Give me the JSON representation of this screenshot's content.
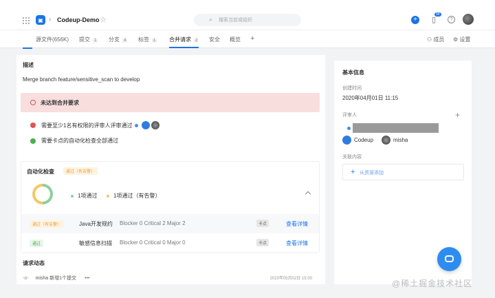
{
  "header": {
    "repo_name": "Codeup-Demo",
    "search_placeholder": "搜索当前或组织",
    "notify_count": "99"
  },
  "tabs": [
    {
      "label": "源文件(656K)",
      "count": ""
    },
    {
      "label": "提交",
      "count": "1"
    },
    {
      "label": "分支",
      "count": "4"
    },
    {
      "label": "标签",
      "count": "1"
    },
    {
      "label": "合并请求",
      "count": "2"
    },
    {
      "label": "安全",
      "count": ""
    },
    {
      "label": "概览",
      "count": ""
    }
  ],
  "tab_right": {
    "members": "成员",
    "settings": "设置"
  },
  "main": {
    "desc_title": "描述",
    "desc_text": "Merge branch feature/sensitive_scan to develop",
    "warning": "未达到合并要求",
    "checks": [
      {
        "text": "需要至少1名有权限的评审人评审通过",
        "status": "fail"
      },
      {
        "text": "需要卡点的自动化检查全部通过",
        "status": "pass"
      }
    ],
    "auto": {
      "title": "自动化检查",
      "status_tag": "通过（有告警）",
      "legend_pass": "1项通过",
      "legend_warn": "1项通过（有告警）",
      "rows": [
        {
          "tag": "通过（有告警）",
          "tag_type": "warn",
          "name": "Java开发规约",
          "detail": "Blocker 0 Critical 2 Major 2",
          "chip": "卡点",
          "link": "查看详情"
        },
        {
          "tag": "通过",
          "tag_type": "ok",
          "name": "敏感信息扫描",
          "detail": "Blocker 0 Critical 0 Major 0",
          "chip": "卡点",
          "link": "查看详情"
        }
      ]
    },
    "activity": {
      "title": "请求动态",
      "user": "misha",
      "action": "新增1个提交",
      "more": "•••",
      "time": "2020年05月02日 15:00"
    }
  },
  "side": {
    "title": "基本信息",
    "created_label": "创建时间",
    "created_value": "2020年04月01日 11:15",
    "reviewer_label": "评审人",
    "reviewers": [
      "Codeup",
      "misha"
    ],
    "related_label": "关联内容",
    "add_label": "从资源添加"
  },
  "watermark": "@稀土掘金技术社区",
  "colors": {
    "accent": "#1b73e8",
    "warn_bg": "#f9dede",
    "pass": "#4caf50",
    "fail": "#e05555"
  }
}
